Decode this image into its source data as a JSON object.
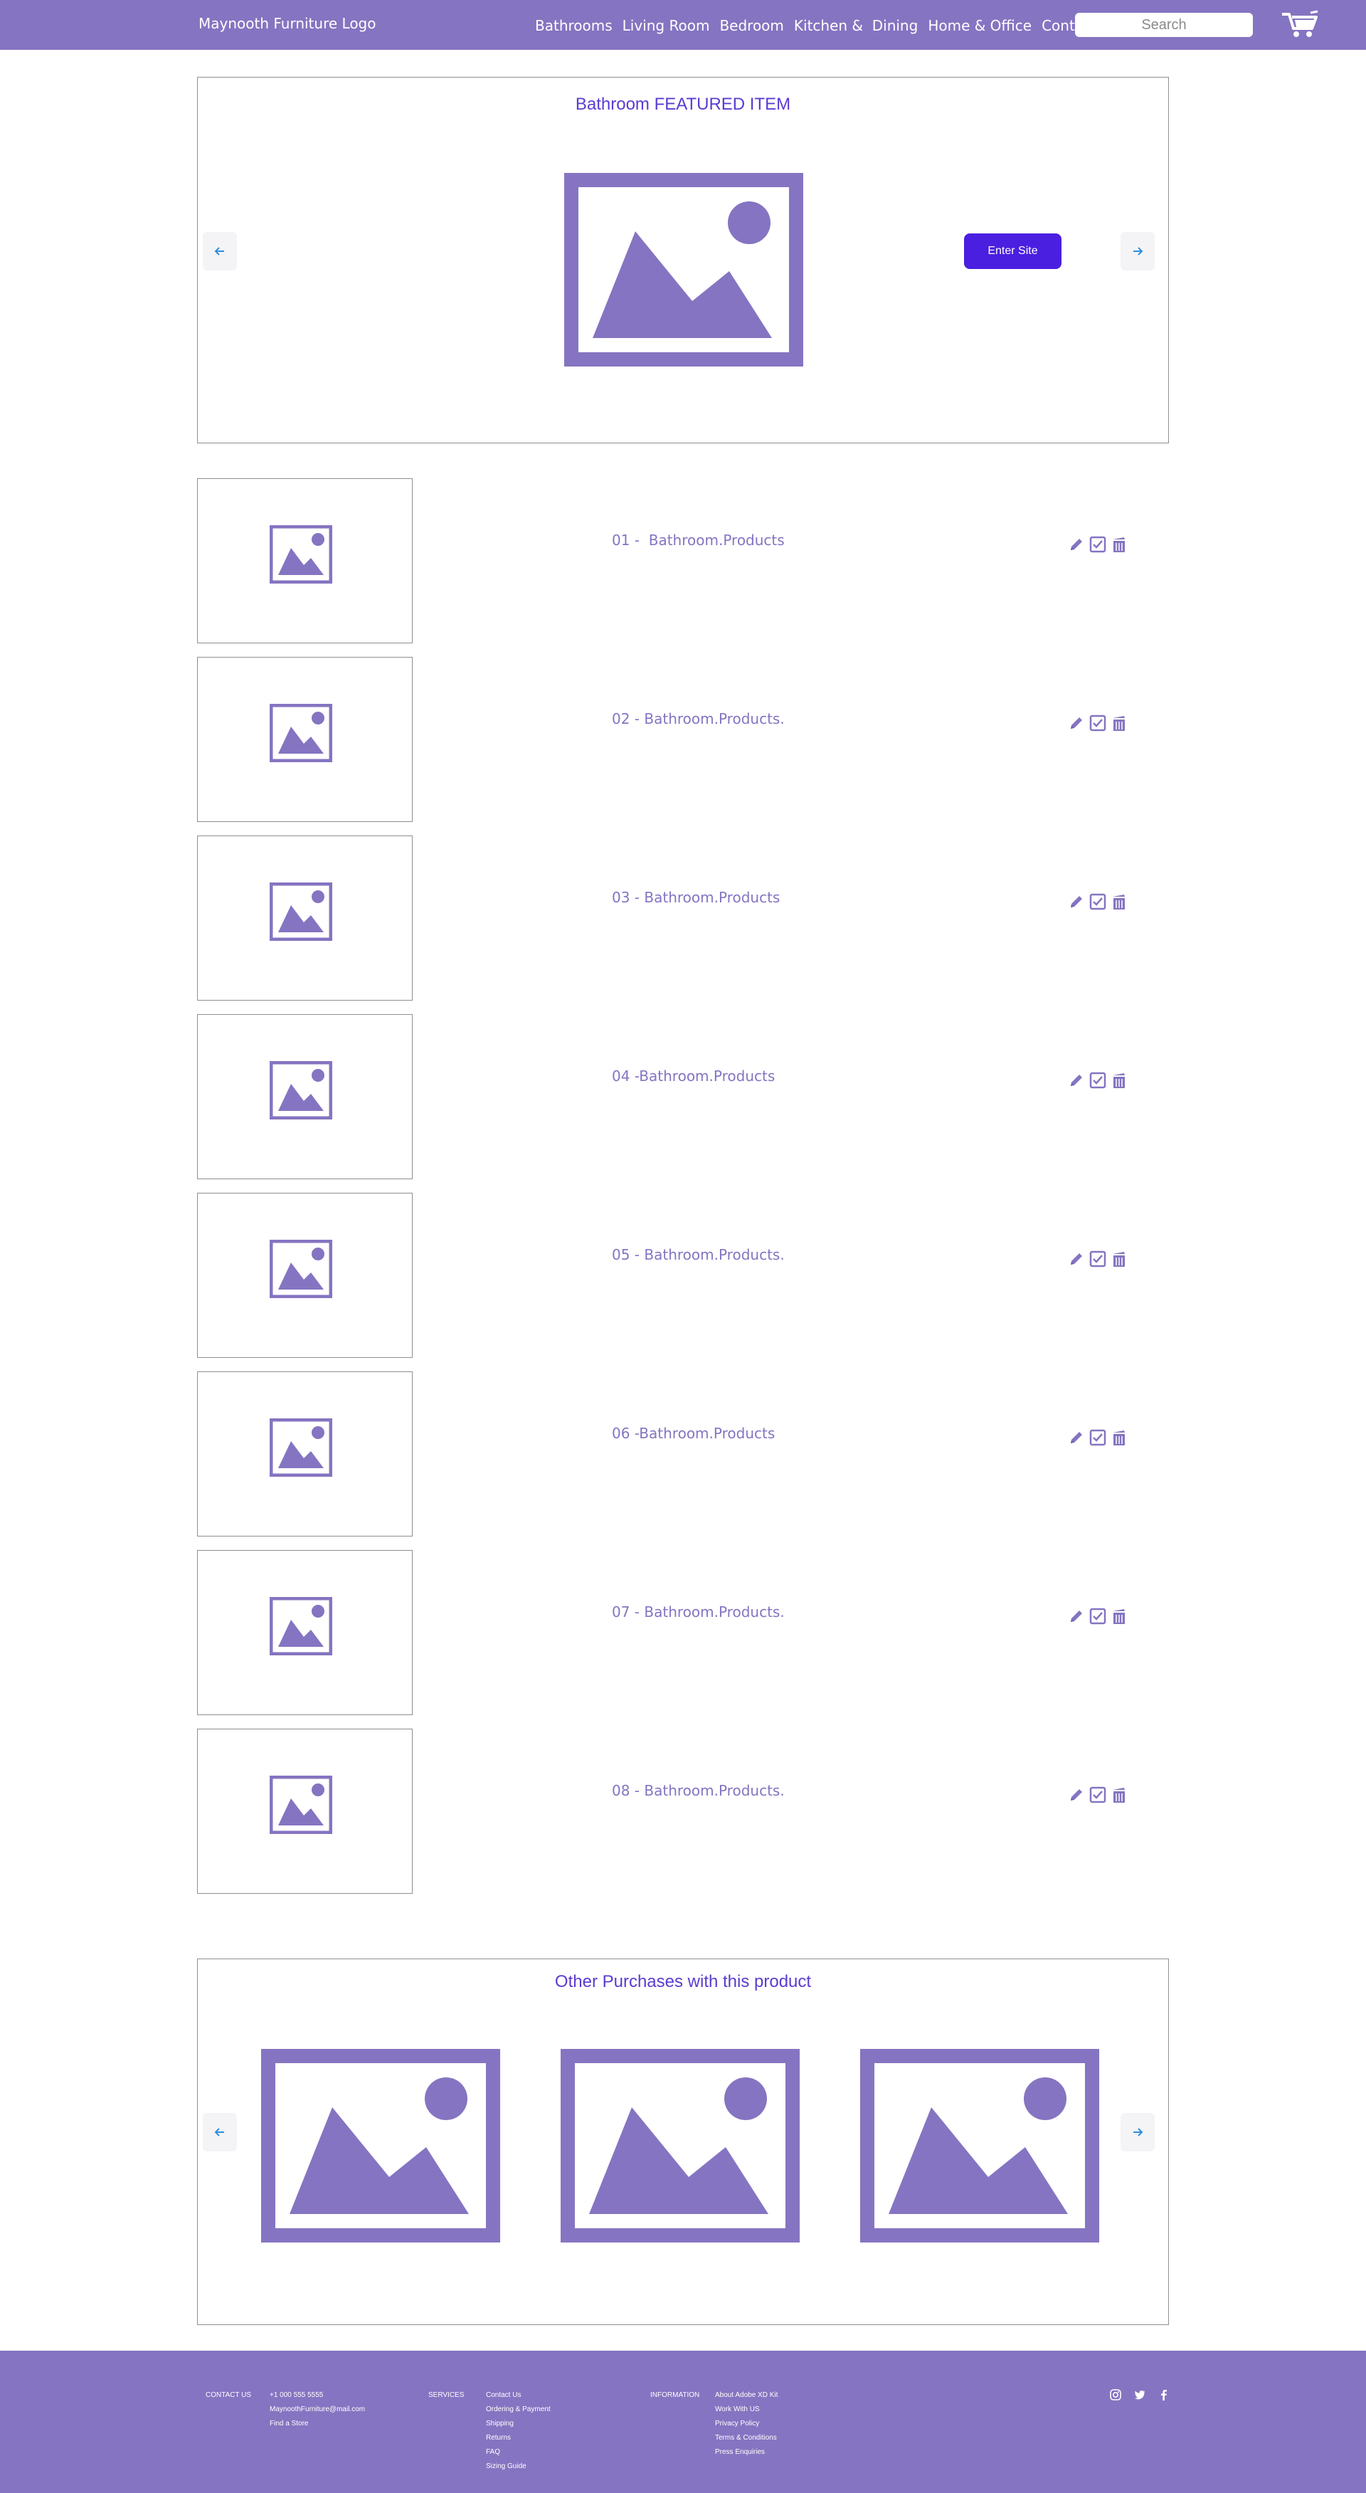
{
  "header": {
    "logo": "Maynooth Furniture Logo",
    "nav": [
      "Bathrooms",
      "Living Room",
      "Bedroom",
      "Kitchen &  Dining",
      "Home & Office",
      "Contact Us"
    ],
    "search_placeholder": "Search",
    "cart_icon": "cart-icon"
  },
  "featured": {
    "title": "Bathroom FEATURED ITEM",
    "enter_label": "Enter Site"
  },
  "products": [
    "01 -  Bathroom.Products",
    "02 - Bathroom.Products.",
    "03 - Bathroom.Products",
    "04 -Bathroom.Products",
    "05 - Bathroom.Products.",
    "06 -Bathroom.Products",
    "07 - Bathroom.Products.",
    "08 - Bathroom.Products."
  ],
  "row_actions": [
    "edit-icon",
    "checkbox-icon",
    "delete-icon"
  ],
  "other": {
    "title": "Other Purchases with this product"
  },
  "footer": {
    "contact_heading": "CONTACT US",
    "contact_items": [
      "+1 000 555 5555",
      "MaynoothFurniture@mail.com",
      "Find a Store"
    ],
    "services_heading": "SERVICES",
    "services_items": [
      "Contact Us",
      "Ordering & Payment",
      "Shipping",
      "Returns",
      "FAQ",
      "Sizing Guide"
    ],
    "information_heading": "INFORMATION",
    "information_items": [
      "About Adobe XD Kit",
      "Work With US",
      "Privacy Policy",
      "Terms & Conditions",
      "Press Enquiries"
    ],
    "social": [
      "instagram-icon",
      "twitter-icon",
      "facebook-icon"
    ]
  },
  "colors": {
    "accent": "#8574c1",
    "title": "#5b3bd1",
    "button": "#4a1fe0",
    "arrow": "#2f8fdc"
  }
}
